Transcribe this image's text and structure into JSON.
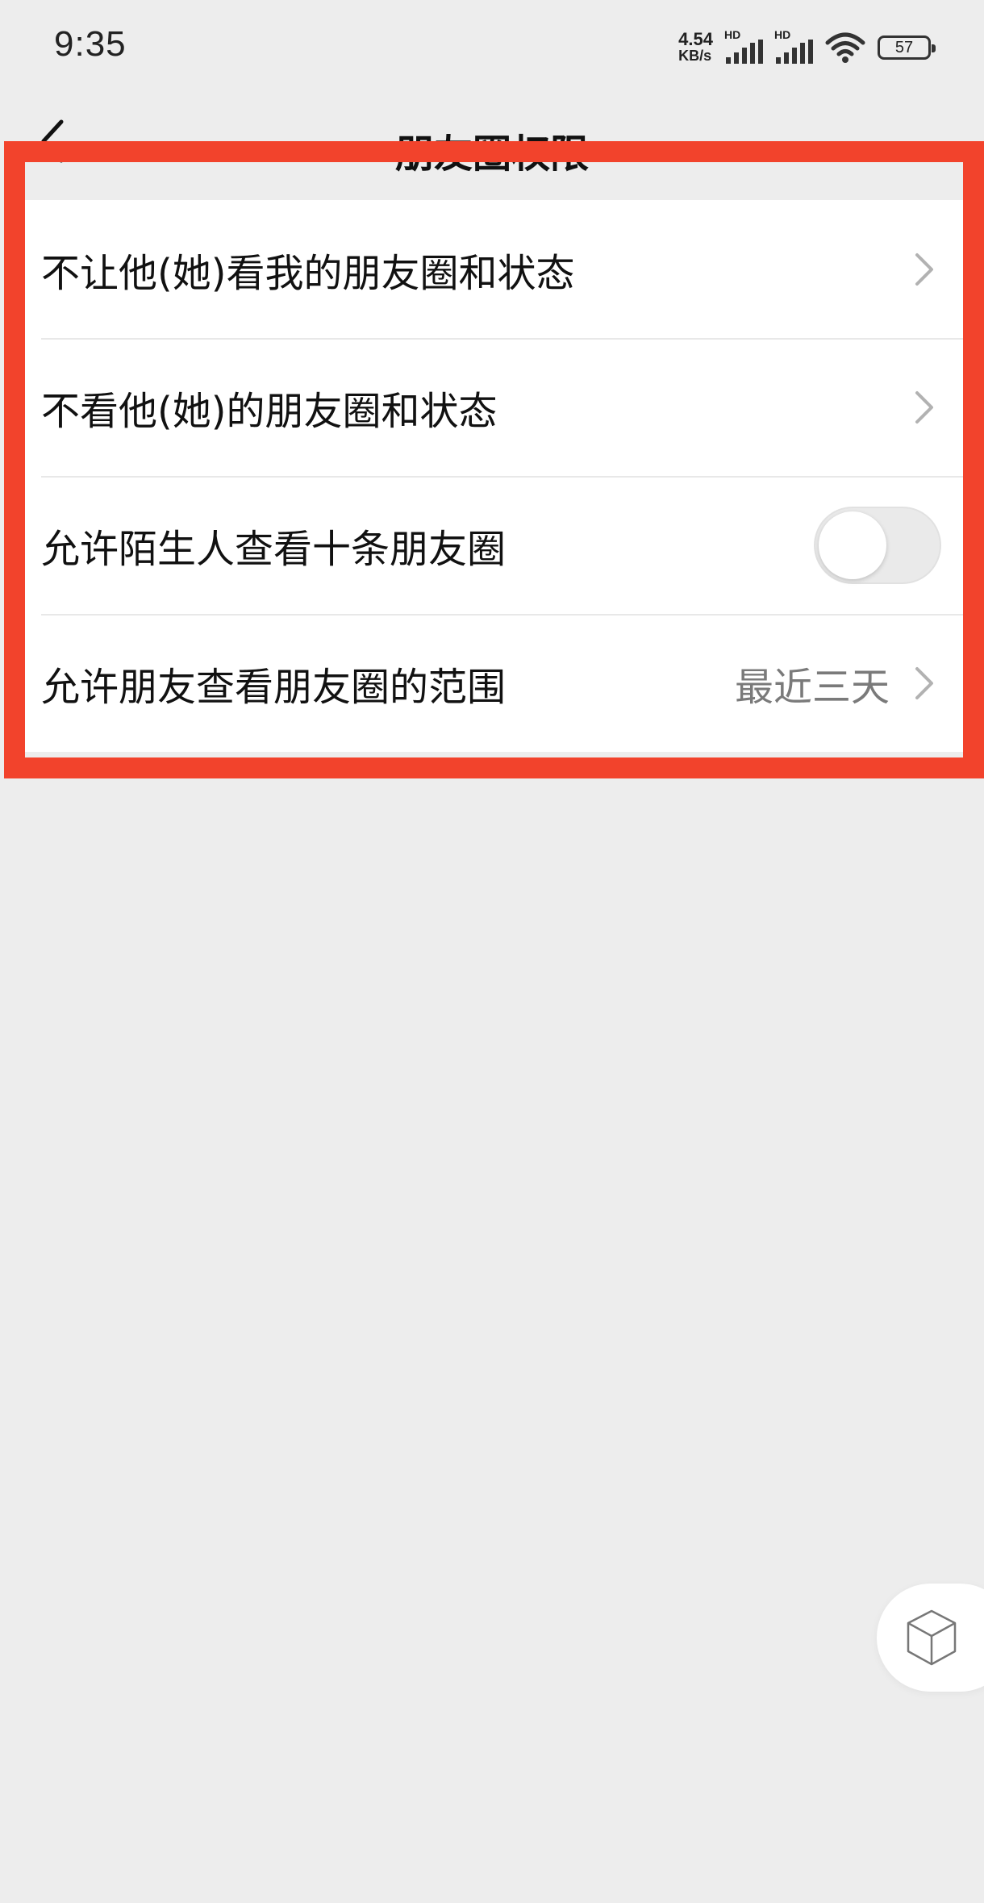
{
  "status_bar": {
    "time": "9:35",
    "net_speed_value": "4.54",
    "net_speed_unit": "KB/s",
    "hd_label_1": "HD",
    "hd_label_2": "HD",
    "battery_level": "57",
    "icons": [
      "signal-icon",
      "signal-icon",
      "wifi-icon",
      "battery-icon"
    ]
  },
  "nav": {
    "title": "朋友圈权限",
    "back_icon": "back-arrow-icon"
  },
  "settings": {
    "items": [
      {
        "label": "不让他(她)看我的朋友圈和状态",
        "control": "chevron"
      },
      {
        "label": "不看他(她)的朋友圈和状态",
        "control": "chevron"
      },
      {
        "label": "允许陌生人查看十条朋友圈",
        "control": "toggle",
        "toggle_on": false
      },
      {
        "label": "允许朋友查看朋友圈的范围",
        "value": "最近三天",
        "control": "chevron"
      }
    ]
  },
  "floating_button": {
    "icon": "cube-icon"
  },
  "colors": {
    "background": "#ededed",
    "highlight": "#f2432c",
    "chevron": "#b2b2b2",
    "value_text": "#7a7a7a"
  }
}
